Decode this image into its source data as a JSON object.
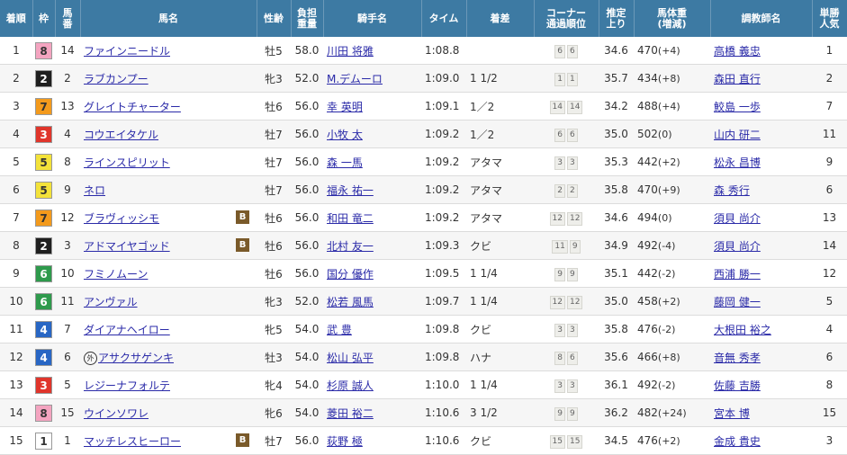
{
  "headers": [
    "着順",
    "枠",
    "馬番",
    "馬名",
    "性齢",
    "負担重量",
    "騎手名",
    "タイム",
    "着差",
    "コーナー通過順位",
    "推定上り",
    "馬体重(増減)",
    "調教師名",
    "単勝人気"
  ],
  "headerLines": [
    [
      "着順"
    ],
    [
      "枠"
    ],
    [
      "馬",
      "番"
    ],
    [
      "馬名"
    ],
    [
      "性齢"
    ],
    [
      "負担",
      "重量"
    ],
    [
      "騎手名"
    ],
    [
      "タイム"
    ],
    [
      "着差"
    ],
    [
      "コーナー",
      "通過順位"
    ],
    [
      "推定",
      "上り"
    ],
    [
      "馬体重",
      "(増減)"
    ],
    [
      "調教師名"
    ],
    [
      "単勝",
      "人気"
    ]
  ],
  "wakuColors": {
    "1": {
      "bg": "#ffffff",
      "fg": "#333333"
    },
    "2": {
      "bg": "#1f1f1f",
      "fg": "#ffffff"
    },
    "3": {
      "bg": "#e0352b",
      "fg": "#ffffff"
    },
    "4": {
      "bg": "#2866c4",
      "fg": "#ffffff"
    },
    "5": {
      "bg": "#f3e23a",
      "fg": "#333333"
    },
    "6": {
      "bg": "#2e9a4c",
      "fg": "#ffffff"
    },
    "7": {
      "bg": "#f39a1c",
      "fg": "#333333"
    },
    "8": {
      "bg": "#f4a4c0",
      "fg": "#333333"
    }
  },
  "rows": [
    {
      "rank": "1",
      "waku": "8",
      "num": "14",
      "horse": "ファインニードル",
      "blinker": false,
      "foreign": false,
      "sex": "牡5",
      "weight": "58.0",
      "jockey": "川田 将雅",
      "time": "1:08.8",
      "margin": "",
      "corners": [
        "6",
        "6"
      ],
      "last3f": "34.6",
      "bw": "470",
      "bwd": "(+4)",
      "trainer": "高橋 義忠",
      "pop": "1"
    },
    {
      "rank": "2",
      "waku": "2",
      "num": "2",
      "horse": "ラブカンプー",
      "blinker": false,
      "foreign": false,
      "sex": "牝3",
      "weight": "52.0",
      "jockey": "M.デムーロ",
      "time": "1:09.0",
      "margin": "1 1/2",
      "corners": [
        "1",
        "1"
      ],
      "last3f": "35.7",
      "bw": "434",
      "bwd": "(+8)",
      "trainer": "森田 直行",
      "pop": "2"
    },
    {
      "rank": "3",
      "waku": "7",
      "num": "13",
      "horse": "グレイトチャーター",
      "blinker": false,
      "foreign": false,
      "sex": "牡6",
      "weight": "56.0",
      "jockey": "幸 英明",
      "time": "1:09.1",
      "margin": "1／2",
      "corners": [
        "14",
        "14"
      ],
      "last3f": "34.2",
      "bw": "488",
      "bwd": "(+4)",
      "trainer": "鮫島 一歩",
      "pop": "7"
    },
    {
      "rank": "4",
      "waku": "3",
      "num": "4",
      "horse": "コウエイタケル",
      "blinker": false,
      "foreign": false,
      "sex": "牡7",
      "weight": "56.0",
      "jockey": "小牧 太",
      "time": "1:09.2",
      "margin": "1／2",
      "corners": [
        "6",
        "6"
      ],
      "last3f": "35.0",
      "bw": "502",
      "bwd": "(0)",
      "trainer": "山内 研二",
      "pop": "11"
    },
    {
      "rank": "5",
      "waku": "5",
      "num": "8",
      "horse": "ラインスピリット",
      "blinker": false,
      "foreign": false,
      "sex": "牡7",
      "weight": "56.0",
      "jockey": "森 一馬",
      "time": "1:09.2",
      "margin": "アタマ",
      "corners": [
        "3",
        "3"
      ],
      "last3f": "35.3",
      "bw": "442",
      "bwd": "(+2)",
      "trainer": "松永 昌博",
      "pop": "9"
    },
    {
      "rank": "6",
      "waku": "5",
      "num": "9",
      "horse": "ネロ",
      "blinker": false,
      "foreign": false,
      "sex": "牡7",
      "weight": "56.0",
      "jockey": "福永 祐一",
      "time": "1:09.2",
      "margin": "アタマ",
      "corners": [
        "2",
        "2"
      ],
      "last3f": "35.8",
      "bw": "470",
      "bwd": "(+9)",
      "trainer": "森 秀行",
      "pop": "6"
    },
    {
      "rank": "7",
      "waku": "7",
      "num": "12",
      "horse": "ブラヴィッシモ",
      "blinker": true,
      "foreign": false,
      "sex": "牡6",
      "weight": "56.0",
      "jockey": "和田 竜二",
      "time": "1:09.2",
      "margin": "アタマ",
      "corners": [
        "12",
        "12"
      ],
      "last3f": "34.6",
      "bw": "494",
      "bwd": "(0)",
      "trainer": "須貝 尚介",
      "pop": "13"
    },
    {
      "rank": "8",
      "waku": "2",
      "num": "3",
      "horse": "アドマイヤゴッド",
      "blinker": true,
      "foreign": false,
      "sex": "牡6",
      "weight": "56.0",
      "jockey": "北村 友一",
      "time": "1:09.3",
      "margin": "クビ",
      "corners": [
        "11",
        "9"
      ],
      "last3f": "34.9",
      "bw": "492",
      "bwd": "(-4)",
      "trainer": "須貝 尚介",
      "pop": "14"
    },
    {
      "rank": "9",
      "waku": "6",
      "num": "10",
      "horse": "フミノムーン",
      "blinker": false,
      "foreign": false,
      "sex": "牡6",
      "weight": "56.0",
      "jockey": "国分 優作",
      "time": "1:09.5",
      "margin": "1 1/4",
      "corners": [
        "9",
        "9"
      ],
      "last3f": "35.1",
      "bw": "442",
      "bwd": "(-2)",
      "trainer": "西浦 勝一",
      "pop": "12"
    },
    {
      "rank": "10",
      "waku": "6",
      "num": "11",
      "horse": "アンヴァル",
      "blinker": false,
      "foreign": false,
      "sex": "牝3",
      "weight": "52.0",
      "jockey": "松若 風馬",
      "time": "1:09.7",
      "margin": "1 1/4",
      "corners": [
        "12",
        "12"
      ],
      "last3f": "35.0",
      "bw": "458",
      "bwd": "(+2)",
      "trainer": "藤岡 健一",
      "pop": "5"
    },
    {
      "rank": "11",
      "waku": "4",
      "num": "7",
      "horse": "ダイアナヘイロー",
      "blinker": false,
      "foreign": false,
      "sex": "牝5",
      "weight": "54.0",
      "jockey": "武 豊",
      "time": "1:09.8",
      "margin": "クビ",
      "corners": [
        "3",
        "3"
      ],
      "last3f": "35.8",
      "bw": "476",
      "bwd": "(-2)",
      "trainer": "大根田 裕之",
      "pop": "4"
    },
    {
      "rank": "12",
      "waku": "4",
      "num": "6",
      "horse": "アサクサゲンキ",
      "blinker": false,
      "foreign": true,
      "sex": "牡3",
      "weight": "54.0",
      "jockey": "松山 弘平",
      "time": "1:09.8",
      "margin": "ハナ",
      "corners": [
        "8",
        "6"
      ],
      "last3f": "35.6",
      "bw": "466",
      "bwd": "(+8)",
      "trainer": "音無 秀孝",
      "pop": "6"
    },
    {
      "rank": "13",
      "waku": "3",
      "num": "5",
      "horse": "レジーナフォルテ",
      "blinker": false,
      "foreign": false,
      "sex": "牝4",
      "weight": "54.0",
      "jockey": "杉原 誠人",
      "time": "1:10.0",
      "margin": "1 1/4",
      "corners": [
        "3",
        "3"
      ],
      "last3f": "36.1",
      "bw": "492",
      "bwd": "(-2)",
      "trainer": "佐藤 吉勝",
      "pop": "8"
    },
    {
      "rank": "14",
      "waku": "8",
      "num": "15",
      "horse": "ウインソワレ",
      "blinker": false,
      "foreign": false,
      "sex": "牝6",
      "weight": "54.0",
      "jockey": "菱田 裕二",
      "time": "1:10.6",
      "margin": "3 1/2",
      "corners": [
        "9",
        "9"
      ],
      "last3f": "36.2",
      "bw": "482",
      "bwd": "(+24)",
      "trainer": "宮本 博",
      "pop": "15"
    },
    {
      "rank": "15",
      "waku": "1",
      "num": "1",
      "horse": "マッチレスヒーロー",
      "blinker": true,
      "foreign": false,
      "sex": "牡7",
      "weight": "56.0",
      "jockey": "荻野 極",
      "time": "1:10.6",
      "margin": "クビ",
      "corners": [
        "15",
        "15"
      ],
      "last3f": "34.5",
      "bw": "476",
      "bwd": "(+2)",
      "trainer": "金成 貴史",
      "pop": "3"
    }
  ]
}
